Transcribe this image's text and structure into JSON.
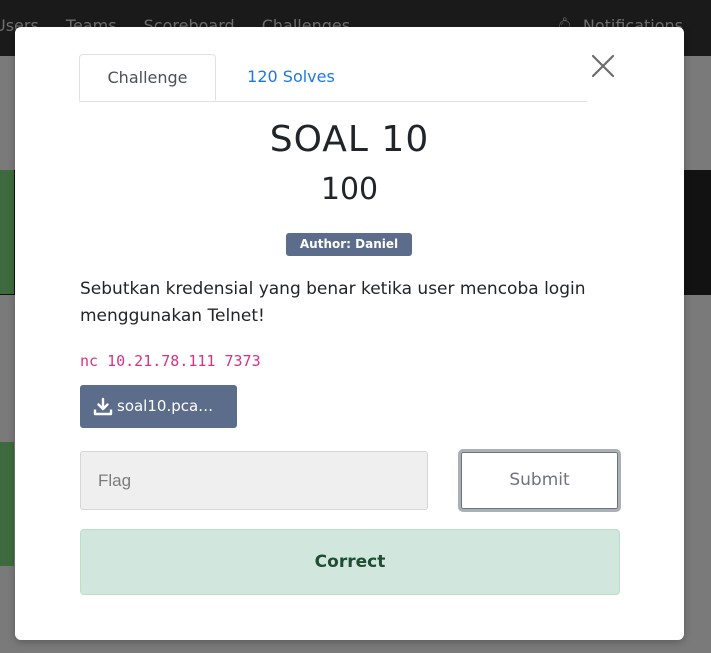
{
  "background": {
    "nav_links": [
      "Users",
      "Teams",
      "Scoreboard",
      "Challenges"
    ],
    "notifications_label": "Notifications"
  },
  "modal": {
    "tabs": [
      {
        "label": "Challenge",
        "active": true
      },
      {
        "label": "120 Solves",
        "active": false
      }
    ],
    "close_icon": "close-icon",
    "title": "SOAL 10",
    "points": "100",
    "author_badge": "Author: Daniel",
    "description": "Sebutkan kredensial yang benar ketika user mencoba login menggunakan Telnet!",
    "connection": "nc 10.21.78.111 7373",
    "download": {
      "icon": "download-icon",
      "label": "soal10.pca…"
    },
    "flag_input": {
      "placeholder": "Flag",
      "value": ""
    },
    "submit_label": "Submit",
    "result_message": "Correct"
  },
  "colors": {
    "accent": "#1f78e0",
    "badge": "#5b6d8a",
    "code": "#d63384",
    "success_bg": "#d1e7dd",
    "success_text": "#1f4d33"
  }
}
